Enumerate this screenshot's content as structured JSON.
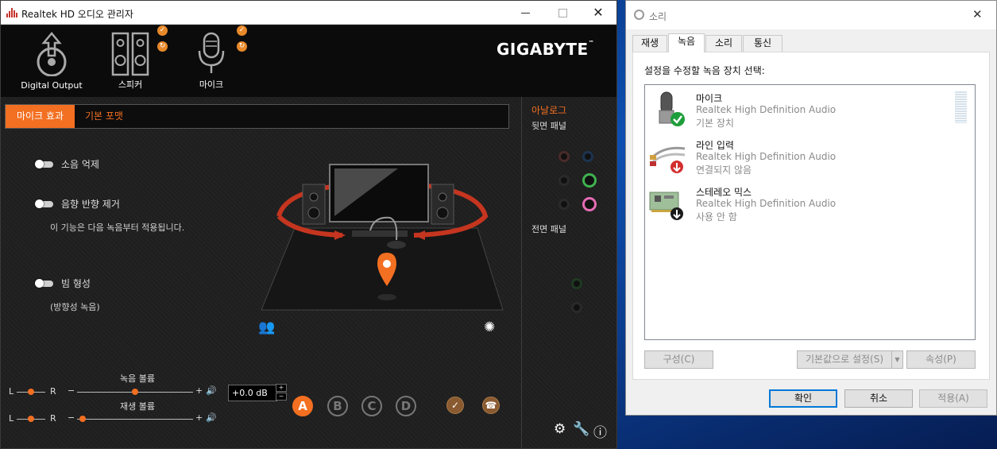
{
  "realtek": {
    "title": "Realtek HD 오디오 관리자",
    "brand": "GIGABYTE",
    "devices": [
      {
        "label": "Digital Output",
        "icon": "digital-output-icon"
      },
      {
        "label": "스피커",
        "icon": "speaker-icon"
      },
      {
        "label": "마이크",
        "icon": "microphone-icon"
      }
    ],
    "tabs": {
      "active": "마이크 효과",
      "inactive": "기본 포맷"
    },
    "options": {
      "noise": "소음 억제",
      "echo": "음향 반향 제거",
      "echo_note": "이 기능은 다음 녹음부터 적용됩니다.",
      "beam": "빔 형성",
      "beam_note": "(방향성 녹음)"
    },
    "analog": {
      "title": "아날로그",
      "back": "뒷면 패널",
      "front": "전면 패널"
    },
    "volume": {
      "rec_label": "녹음 볼륨",
      "play_label": "재생 볼륨",
      "left": "L",
      "right": "R",
      "minus": "−",
      "plus": "+",
      "db": "+0.0 dB",
      "rec_level": 0.5,
      "play_level": 0.05,
      "balance": 0.5
    },
    "presets": [
      "A",
      "B",
      "C",
      "D"
    ],
    "colors": {
      "accent": "#f36f21",
      "jack_green": "#3fb34f",
      "jack_pink": "#e56cb5"
    }
  },
  "sound": {
    "title": "소리",
    "tabs": [
      "재생",
      "녹음",
      "소리",
      "통신"
    ],
    "active_tab": "녹음",
    "instruction": "설정을 수정할 녹음 장치 선택:",
    "devices": [
      {
        "name": "마이크",
        "driver": "Realtek High Definition Audio",
        "status": "기본 장치",
        "icon": "microphone-device-icon"
      },
      {
        "name": "라인 입력",
        "driver": "Realtek High Definition Audio",
        "status": "연결되지 않음",
        "icon": "line-in-icon"
      },
      {
        "name": "스테레오 믹스",
        "driver": "Realtek High Definition Audio",
        "status": "사용 안 함",
        "icon": "sound-card-icon"
      }
    ],
    "buttons": {
      "configure": "구성(C)",
      "set_default": "기본값으로 설정(S)",
      "properties": "속성(P)",
      "ok": "확인",
      "cancel": "취소",
      "apply": "적용(A)"
    }
  }
}
